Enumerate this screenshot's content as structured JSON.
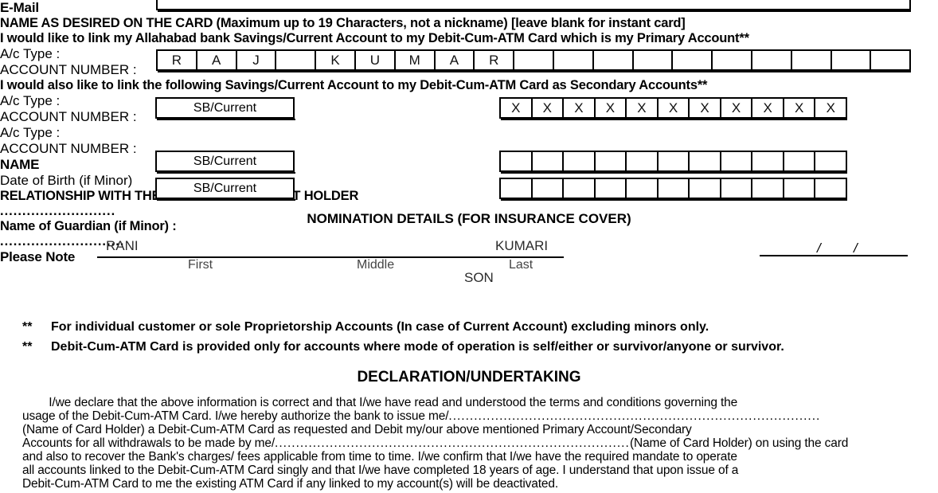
{
  "form": {
    "email": {
      "label": "E-Mail",
      "value": ""
    },
    "card_name": {
      "heading": "NAME AS DESIRED ON THE CARD (Maximum up to 19 Characters, not a nickname) [leave blank for instant card]",
      "cells": [
        "R",
        "A",
        "J",
        "",
        "K",
        "U",
        "M",
        "A",
        "R",
        "",
        "",
        "",
        "",
        "",
        "",
        "",
        "",
        "",
        ""
      ]
    },
    "primary": {
      "statement": "I would like to link my Allahabad bank Savings/Current Account to my Debit-Cum-ATM Card which is my Primary Account**",
      "actype_label": "A/c Type :",
      "actype_value": "SB/Current",
      "account_label": "ACCOUNT NUMBER  :",
      "account_cells": [
        "X",
        "X",
        "X",
        "X",
        "X",
        "X",
        "X",
        "X",
        "X",
        "X",
        "X"
      ]
    },
    "secondary": {
      "statement": "I would also like to link the following Savings/Current Account to my Debit-Cum-ATM Card as Secondary Accounts**",
      "rows": [
        {
          "actype_label": "A/c Type :",
          "actype_value": "SB/Current",
          "account_label": "ACCOUNT NUMBER  :",
          "account_cells": [
            "",
            "",
            "",
            "",
            "",
            "",
            "",
            "",
            "",
            "",
            ""
          ]
        },
        {
          "actype_label": "A/c Type :",
          "actype_value": "SB/Current",
          "account_label": "ACCOUNT NUMBER  :",
          "account_cells": [
            "",
            "",
            "",
            "",
            "",
            "",
            "",
            "",
            "",
            "",
            ""
          ]
        }
      ]
    },
    "nomination": {
      "title": "NOMINATION DETAILS (FOR INSURANCE COVER)",
      "name_label": "NAME",
      "first_value": "RANI",
      "middle_value": "",
      "last_value": "KUMARI",
      "first_sublabel": "First",
      "middle_sublabel": "Middle",
      "last_sublabel": "Last",
      "dob_label": "Date of Birth (if Minor)",
      "dob_day": "",
      "dob_month": "",
      "dob_year": "",
      "dob_sep1": "/",
      "dob_sep2": "/",
      "relationship_label": "RELATIONSHIP WITH THE FIRST HOLDER/JOINT HOLDER",
      "relationship_value": "SON",
      "guardian_label": "Name of Guardian (if Minor) :",
      "guardian_value": ""
    },
    "notes": {
      "heading": "Please Note",
      "items": [
        {
          "marker": "**",
          "text": "For individual customer or sole Proprietorship Accounts (In case of Current Account) excluding minors only."
        },
        {
          "marker": "**",
          "text": "Debit-Cum-ATM Card is provided only for accounts where mode of operation is self/either or survivor/anyone or survivor."
        }
      ]
    },
    "declaration": {
      "title": "DECLARATION/UNDERTAKING",
      "line1": "        I/we declare that the above information is correct and that I/we have read and understood the terms and conditions governing the",
      "line2_pre": "usage of the Debit-Cum-ATM Card. I/we hereby authorize the bank to issue me/",
      "line3": "(Name of Card Holder) a Debit-Cum-ATM Card as requested and Debit my/our above mentioned Primary Account/Secondary",
      "line4_pre": "Accounts for all withdrawals to be made by me/",
      "line4_post": "(Name of Card Holder) on using the card",
      "line5": "and also to recover the Bank's charges/ fees applicable from time to time. I/we confirm that I/we have the required mandate to operate",
      "line6": "all accounts linked to the Debit-Cum-ATM Card singly and that I/we have completed 18 years of age. I understand that upon issue of a",
      "line7": "Debit-Cum-ATM Card to me the existing ATM Card if any linked to my account(s) will be deactivated."
    }
  },
  "colors": {
    "ink": "#000000",
    "handwriting": "#2b2b2b",
    "paper": "#ffffff"
  }
}
